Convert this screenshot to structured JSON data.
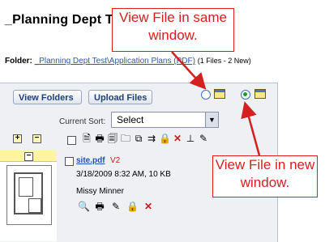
{
  "page": {
    "title": "_Planning Dept T"
  },
  "folder": {
    "label": "Folder:",
    "path": "_Planning Dept Test\\Application Plans (PDF)",
    "count": "(1 Files - 2 New)"
  },
  "toolbar": {
    "view_folders": "View Folders",
    "upload_files": "Upload Files",
    "sort_label": "Current Sort:",
    "sort_value": "Select"
  },
  "file": {
    "name": "site.pdf",
    "version": "V2",
    "date_size": "3/18/2009 8:32 AM, 10 KB",
    "owner": "Missy Minner"
  },
  "callouts": {
    "same_window": "View File in same window.",
    "new_window": "View File in new window."
  },
  "colors": {
    "callout": "#d42020",
    "accent": "#3b6fd0",
    "header_band": "#fff5a0"
  }
}
